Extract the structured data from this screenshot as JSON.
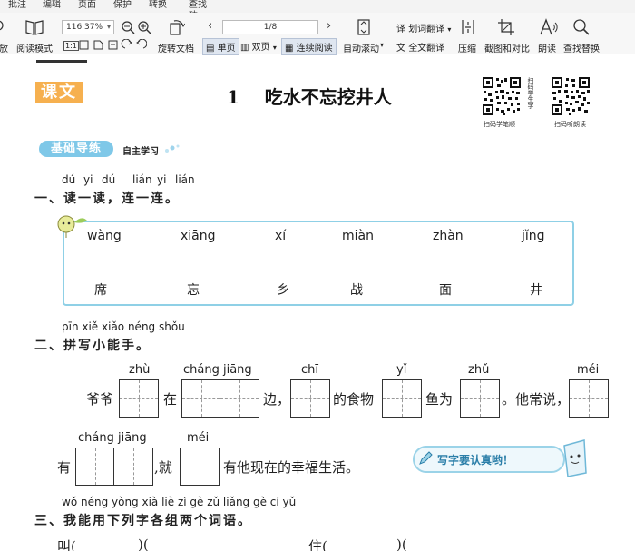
{
  "menu": {
    "items": [
      "批注",
      "编辑",
      "页面",
      "保护",
      "转换"
    ],
    "search_placeholder": "查找功能、文档内容"
  },
  "toolbar": {
    "read_mode": "阅读模式",
    "zoom": "116.37%",
    "rotate_doc": "旋转文档",
    "single_page": "单页",
    "double_page": "双页",
    "continuous": "连续阅读",
    "page_indicator": "1/8",
    "auto_scroll": "自动滚动",
    "word_translate": "划词翻译",
    "full_translate": "全文翻译",
    "compress": "压缩",
    "screenshot_compare": "截图和对比",
    "read_aloud": "朗读",
    "find_replace": "查找替换",
    "fit_label": "1:1",
    "left_cut_label": "放"
  },
  "document": {
    "section_tag": "课文",
    "lesson_number": "1",
    "lesson_title": "吃水不忘挖井人",
    "qr1_caption": "扫码学笔顺",
    "qr1_side": "扫码学生字",
    "qr2_caption": "扫码听朗读",
    "practice_tag": "基础导练",
    "self_study": "自主学习",
    "q1": {
      "pinyin": [
        "dú",
        "yi",
        "dú",
        "lián",
        "yi",
        "lián"
      ],
      "heading": "一、读一读，连一连。",
      "pinyin_row": [
        "wàng",
        "xiāng",
        "xí",
        "miàn",
        "zhàn",
        "jǐng"
      ],
      "char_row": [
        "席",
        "忘",
        "乡",
        "战",
        "面",
        "井"
      ]
    },
    "q2": {
      "pinyin": "pīn xiě xiǎo néng shǒu",
      "heading": "二、拼写小能手。",
      "line1": {
        "p_zhu": "zhù",
        "p_changjiang": "cháng jiāng",
        "p_chi": "chī",
        "p_yi": "yǐ",
        "p_zhu2": "zhǔ",
        "p_mei": "méi",
        "t1": "爷爷",
        "t2": "在",
        "t3": "边，",
        "t4": "的食物",
        "t5": "鱼为",
        "t6": "。他常说，"
      },
      "line2": {
        "p_changjiang": "cháng jiāng",
        "p_mei": "méi",
        "t1": "有",
        "t2": ",就",
        "t3": "有他现在的幸福生活。"
      },
      "bubble": "写字要认真哟！"
    },
    "q3": {
      "pinyin": "wǒ néng yòng xià liè zì gè zǔ liǎng gè cí yǔ",
      "heading": "三、我能用下列字各组两个词语。",
      "partial_left": "叫(",
      "partial_mid": ")(",
      "partial_right": "住(",
      "partial_end": ")("
    }
  }
}
